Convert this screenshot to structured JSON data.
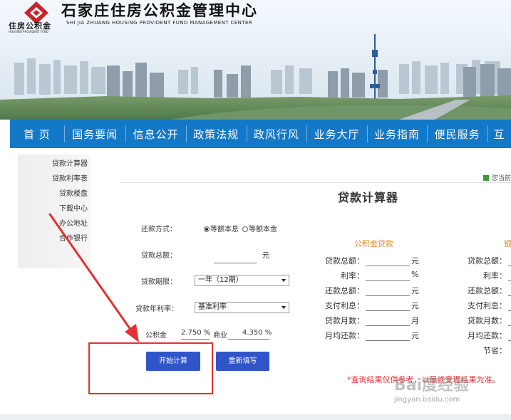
{
  "header": {
    "logo_cn": "住房公积金",
    "logo_en": "HOUSING PROVIDENT FUND",
    "title": "石家庄住房公积金管理中心",
    "subtitle": "SHI JIA ZHUANG HOUSING PROVIDENT FUND MANAGEMENT CENTER"
  },
  "nav": {
    "items": [
      {
        "label": "首 页"
      },
      {
        "label": "国务要闻"
      },
      {
        "label": "信息公开"
      },
      {
        "label": "政策法规"
      },
      {
        "label": "政风行风"
      },
      {
        "label": "业务大厅"
      },
      {
        "label": "业务指南"
      },
      {
        "label": "便民服务"
      },
      {
        "label": "互"
      }
    ]
  },
  "sidebar": {
    "items": [
      {
        "label": "贷款计算器"
      },
      {
        "label": "贷款利率表"
      },
      {
        "label": "贷款楼盘"
      },
      {
        "label": "下载中心"
      },
      {
        "label": "办公地址"
      },
      {
        "label": "合作银行"
      }
    ]
  },
  "breadcrumb": "您当前",
  "calculator": {
    "title": "贷款计算器",
    "repay_label": "还款方式：",
    "repay_options": [
      {
        "label": "等额本息",
        "selected": true
      },
      {
        "label": "等额本金",
        "selected": false
      }
    ],
    "amount_label": "贷款总额：",
    "amount_unit": "元",
    "term_label": "贷款期限：",
    "term_value": "一年（12期）",
    "rate_label": "贷款年利率：",
    "rate_value": "基准利率",
    "fund_rate_label": "公积金",
    "fund_rate_value": "2.750 %",
    "commercial_label": "商业",
    "commercial_rate_value": "4.350 %",
    "start_button": "开始计算",
    "reset_button": "重新填写",
    "results": {
      "fund_heading": "公积金贷款",
      "bank_heading": "银",
      "rows": [
        {
          "label": "贷款总额：",
          "unit": "元"
        },
        {
          "label": "利率：",
          "unit": "%"
        },
        {
          "label": "还款总额：",
          "unit": "元"
        },
        {
          "label": "支付利息：",
          "unit": "元"
        },
        {
          "label": "贷款月数：",
          "unit": "月"
        },
        {
          "label": "月均还款：",
          "unit": "元"
        }
      ],
      "bank_rows": [
        {
          "label": "贷款总额："
        },
        {
          "label": "利率："
        },
        {
          "label": "还款总额："
        },
        {
          "label": "支付利息："
        },
        {
          "label": "贷款月数："
        },
        {
          "label": "月均还款："
        },
        {
          "label": "节省："
        }
      ]
    },
    "note": "*查询结果仅供参考，以最终受理结果为准。"
  },
  "watermark": {
    "line1": "Bai度经验",
    "line2": "jingyan.baidu.com"
  },
  "colors": {
    "nav": "#1478c8",
    "button": "#2f55c9",
    "accent_orange": "#e58a1f",
    "annotation_red": "#e53030"
  }
}
